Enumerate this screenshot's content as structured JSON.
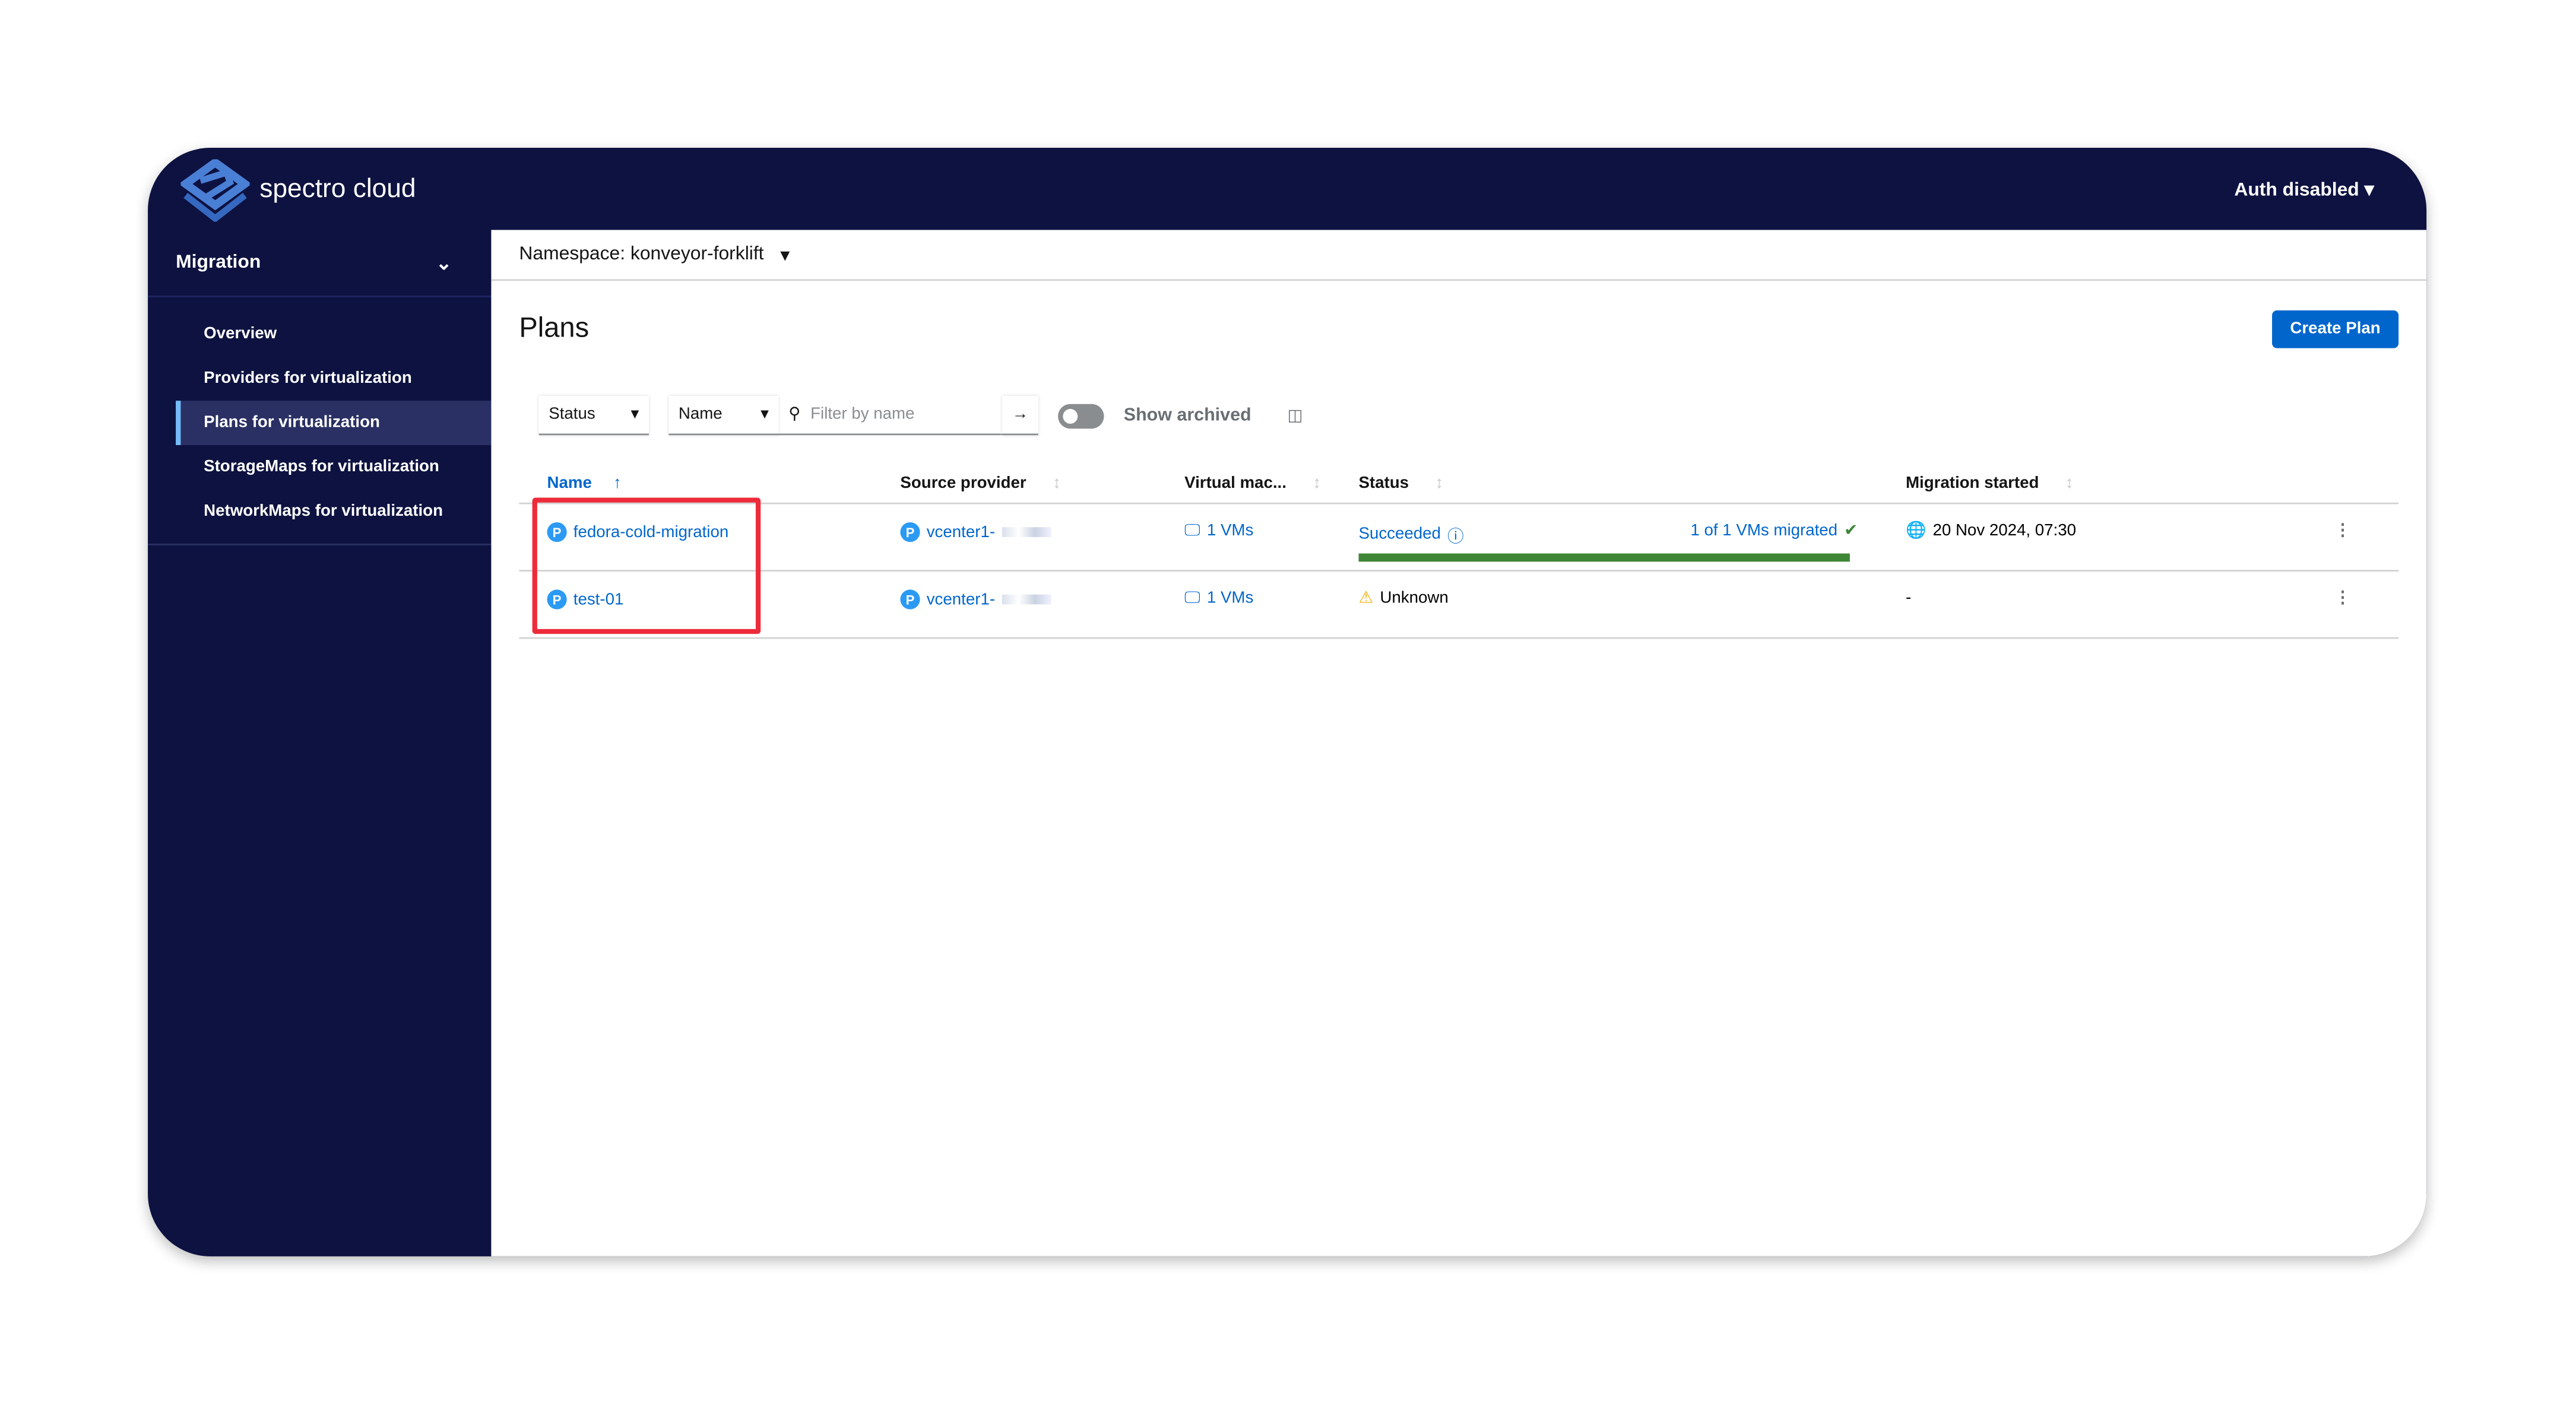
{
  "brand": {
    "name": "spectro cloud"
  },
  "header": {
    "auth": "Auth disabled"
  },
  "sidebar": {
    "group": "Migration",
    "items": [
      {
        "label": "Overview",
        "active": false
      },
      {
        "label": "Providers for virtualization",
        "active": false
      },
      {
        "label": "Plans for virtualization",
        "active": true
      },
      {
        "label": "StorageMaps for virtualization",
        "active": false
      },
      {
        "label": "NetworkMaps for virtualization",
        "active": false
      }
    ]
  },
  "namespace": {
    "label": "Namespace: konveyor-forklift"
  },
  "page": {
    "title": "Plans",
    "create_button": "Create Plan"
  },
  "toolbar": {
    "status_filter": "Status",
    "name_filter": "Name",
    "search_placeholder": "Filter by name",
    "show_archived": "Show archived",
    "show_archived_on": false
  },
  "table": {
    "columns": [
      "Name",
      "Source provider",
      "Virtual mac...",
      "Status",
      "Migration started"
    ],
    "rows": [
      {
        "name": "fedora-cold-migration",
        "provider": "vcenter1-",
        "vms": "1 VMs",
        "status": "Succeeded",
        "progress_text": "1 of 1 VMs migrated",
        "progress": 100,
        "started": "20 Nov 2024, 07:30"
      },
      {
        "name": "test-01",
        "provider": "vcenter1-",
        "vms": "1 VMs",
        "status": "Unknown",
        "started": "-"
      }
    ]
  },
  "colors": {
    "navy": "#0d1240",
    "primary": "#0066cc",
    "success": "#3e8635",
    "warning": "#f0ab00",
    "highlight": "#ee2b3b"
  }
}
